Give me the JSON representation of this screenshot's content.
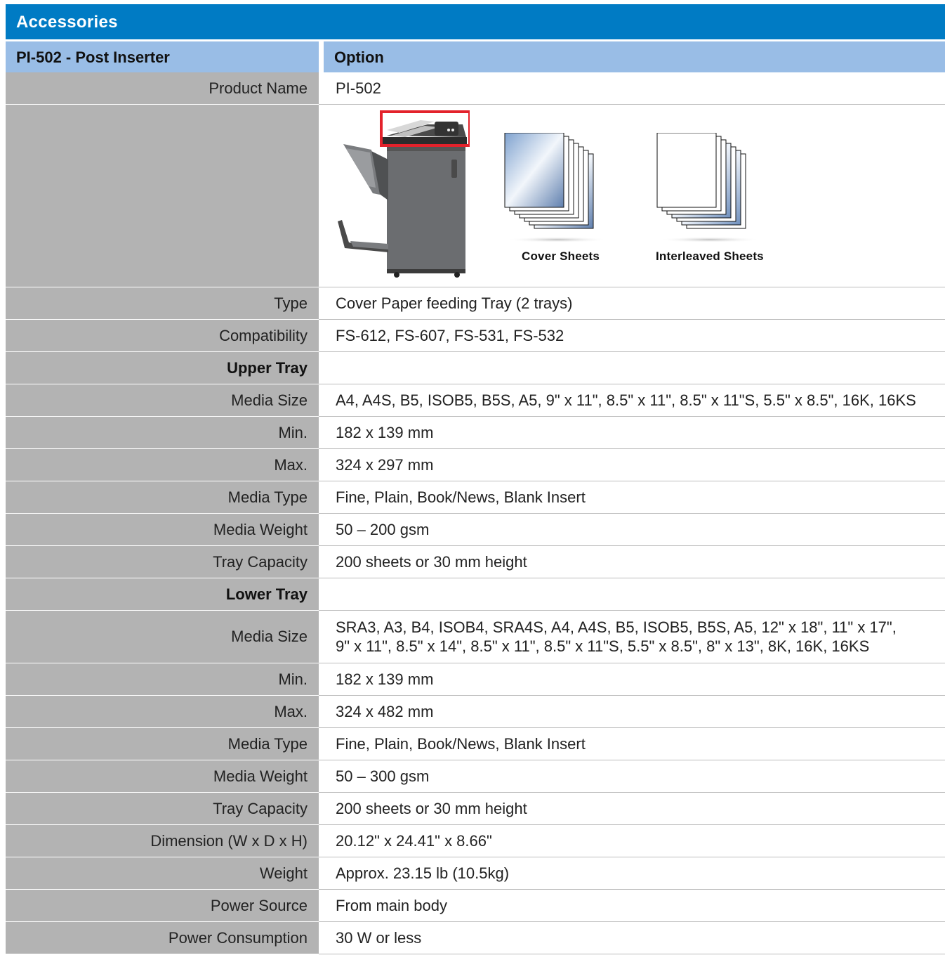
{
  "banner": {
    "title": "Accessories"
  },
  "header": {
    "left": "PI-502 - Post Inserter",
    "right": "Option"
  },
  "product_row": {
    "label": "Product Name",
    "value": "PI-502"
  },
  "image_row": {
    "captions": {
      "cover": "Cover Sheets",
      "interleaved": "Interleaved Sheets"
    },
    "highlight_color": "#e3222b"
  },
  "rows_a": [
    {
      "label": "Type",
      "value": "Cover Paper feeding Tray (2 trays)"
    },
    {
      "label": "Compatibility",
      "value": "FS-612, FS-607, FS-531, FS-532"
    }
  ],
  "upper_tray": {
    "heading": "Upper Tray",
    "rows": [
      {
        "label": "Media Size",
        "value": "A4, A4S, B5, ISOB5, B5S, A5, 9\" x 11\", 8.5\" x 11\", 8.5\" x 11\"S, 5.5\" x 8.5\", 16K, 16KS"
      },
      {
        "label": "Min.",
        "value": "182 x 139 mm"
      },
      {
        "label": "Max.",
        "value": "324 x 297 mm"
      },
      {
        "label": "Media Type",
        "value": "Fine, Plain, Book/News, Blank Insert"
      },
      {
        "label": "Media Weight",
        "value": "50 – 200 gsm"
      },
      {
        "label": "Tray Capacity",
        "value": "200 sheets or 30 mm height"
      }
    ]
  },
  "lower_tray": {
    "heading": "Lower Tray",
    "media_size": {
      "label": "Media Size",
      "line1": "SRA3, A3, B4, ISOB4, SRA4S, A4, A4S, B5, ISOB5, B5S, A5, 12\" x 18\", 11\" x 17\",",
      "line2": "9\" x 11\", 8.5\" x 14\", 8.5\" x 11\", 8.5\" x 11\"S, 5.5\" x 8.5\", 8\" x 13\", 8K, 16K, 16KS"
    },
    "rows": [
      {
        "label": "Min.",
        "value": "182 x 139 mm"
      },
      {
        "label": "Max.",
        "value": "324 x 482 mm"
      },
      {
        "label": "Media Type",
        "value": "Fine, Plain, Book/News, Blank Insert"
      },
      {
        "label": "Media Weight",
        "value": "50 – 300 gsm"
      },
      {
        "label": "Tray Capacity",
        "value": "200 sheets or 30 mm height"
      }
    ]
  },
  "rows_b": [
    {
      "label": "Dimension (W x D x H)",
      "value": "20.12\" x 24.41\" x 8.66\""
    },
    {
      "label": "Weight",
      "value": "Approx. 23.15 lb (10.5kg)"
    },
    {
      "label": "Power Source",
      "value": "From main body"
    },
    {
      "label": "Power Consumption",
      "value": "30 W or less"
    }
  ]
}
